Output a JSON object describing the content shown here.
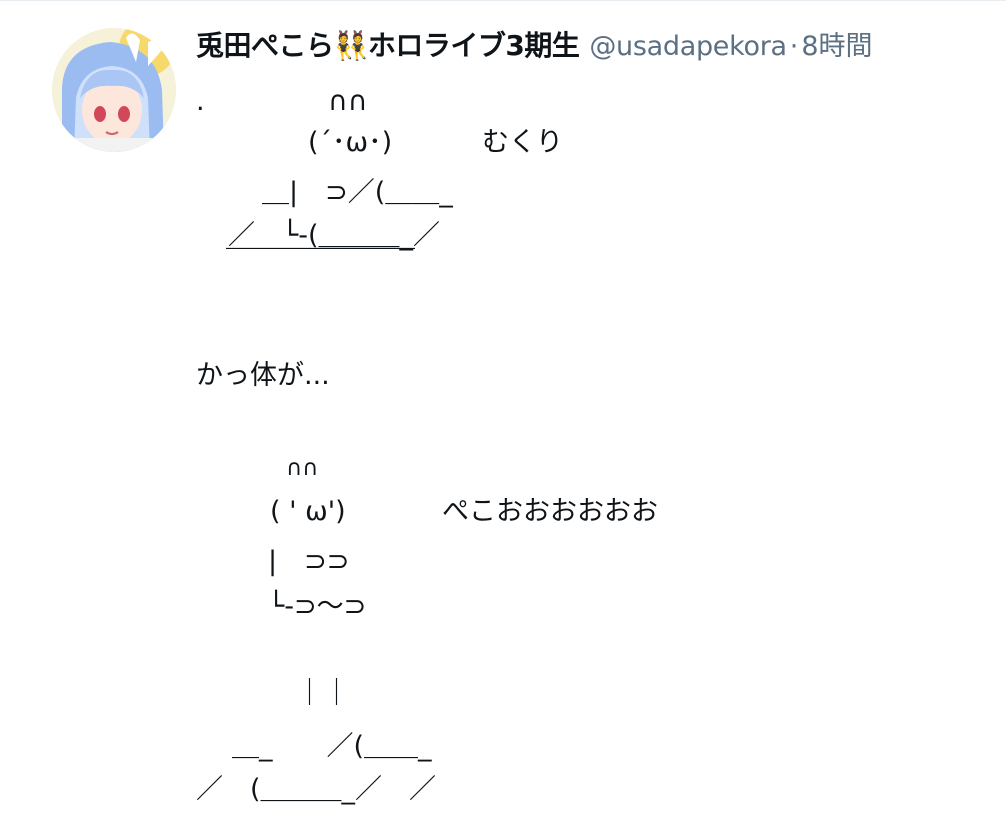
{
  "tweet": {
    "display_name": "兎田ぺこら👯ホロライブ3期生",
    "handle": "@usadapekora",
    "separator": "·",
    "time": "8時間",
    "avatar_icon": "user-avatar-icon",
    "art_lines": [
      ".",
      "∩∩",
      "(´･ω･)",
      "むくり",
      "＿|　⊃／(＿＿_",
      "／　└-(＿＿＿_／",
      "￣￣￣￣￣￣￣",
      "かっ体が...",
      "∩∩",
      "( ' ω')",
      "ぺこおおおおおお",
      "|　⊃⊃",
      "└-⊃〜⊃",
      "｜｜",
      "＿_　　／(＿＿_",
      "／　(＿＿＿_／　／"
    ]
  }
}
